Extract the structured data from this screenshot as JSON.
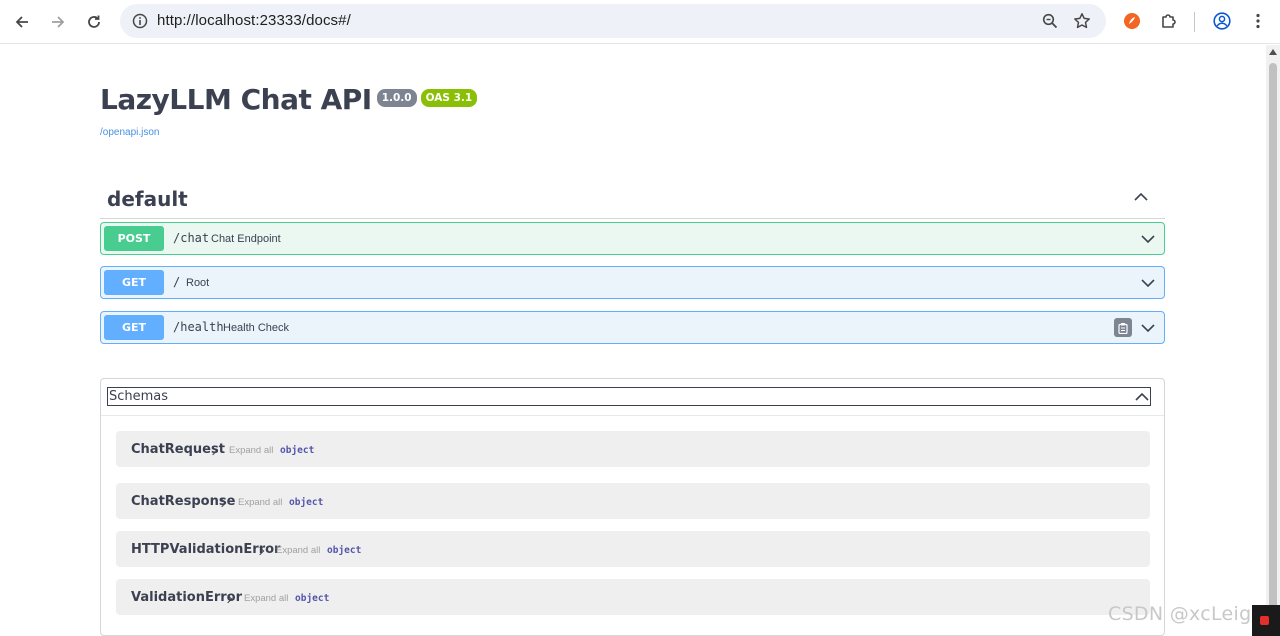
{
  "browser": {
    "url": "http://localhost:23333/docs#/"
  },
  "api": {
    "title": "LazyLLM Chat API",
    "version": "1.0.0",
    "oas": "OAS 3.1",
    "spec_link": "/openapi.json"
  },
  "section": {
    "title": "default",
    "operations": [
      {
        "method": "POST",
        "path": "/chat",
        "summary": "Chat Endpoint"
      },
      {
        "method": "GET",
        "path": "/",
        "summary": "Root"
      },
      {
        "method": "GET",
        "path": "/health",
        "summary": "Health Check"
      }
    ]
  },
  "schemas": {
    "title": "Schemas",
    "expand_label": "Expand all",
    "type_label": "object",
    "items": [
      {
        "name": "ChatRequest"
      },
      {
        "name": "ChatResponse"
      },
      {
        "name": "HTTPValidationError"
      },
      {
        "name": "ValidationError"
      }
    ]
  },
  "watermark": "CSDN @xcLeigh",
  "colors": {
    "post": "#49cc90",
    "get": "#61affe",
    "version_badge": "#7d8492",
    "oas_badge": "#89bf04",
    "link": "#4990e2"
  }
}
